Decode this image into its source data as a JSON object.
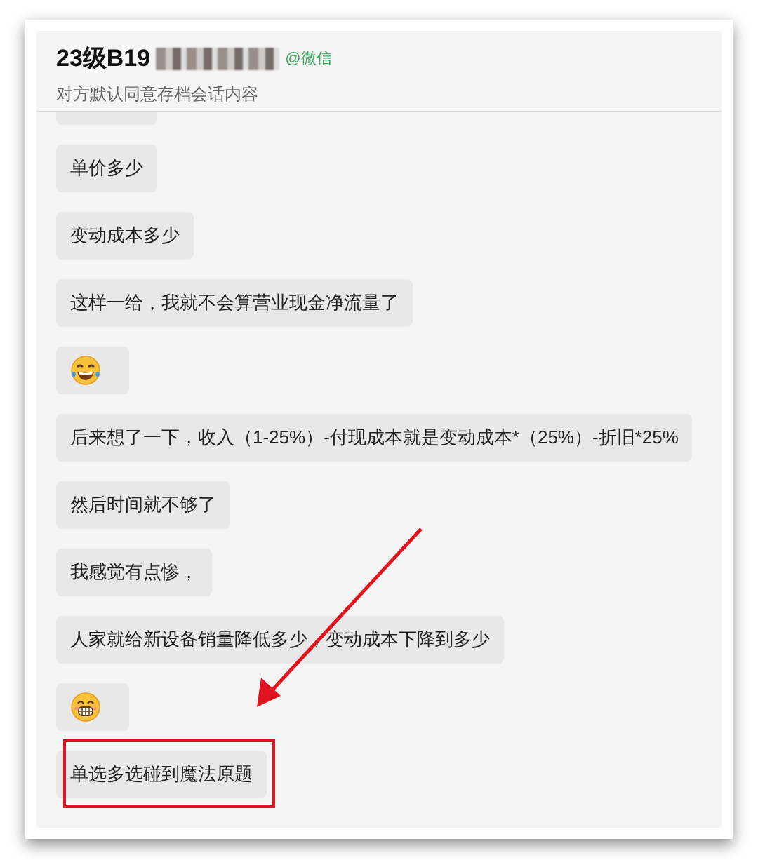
{
  "header": {
    "title": "23级B19",
    "source": "@微信",
    "subtitle": "对方默认同意存档会话内容"
  },
  "messages": [
    {
      "kind": "partial",
      "highlighted": false
    },
    {
      "kind": "text",
      "text": "单价多少",
      "highlighted": false
    },
    {
      "kind": "text",
      "text": "变动成本多少",
      "highlighted": false
    },
    {
      "kind": "text",
      "text": "这样一给，我就不会算营业现金净流量了",
      "highlighted": false
    },
    {
      "kind": "laugh",
      "highlighted": false
    },
    {
      "kind": "text",
      "text": "后来想了一下，收入（1-25%）-付现成本就是变动成本*（25%）-折旧*25%",
      "highlighted": false
    },
    {
      "kind": "text",
      "text": "然后时间就不够了",
      "highlighted": false
    },
    {
      "kind": "text",
      "text": "我感觉有点惨，",
      "highlighted": false
    },
    {
      "kind": "text",
      "text": "人家就给新设备销量降低多少，变动成本下降到多少",
      "highlighted": false
    },
    {
      "kind": "grin",
      "highlighted": false
    },
    {
      "kind": "text",
      "text": "单选多选碰到魔法原题",
      "highlighted": true
    }
  ]
}
